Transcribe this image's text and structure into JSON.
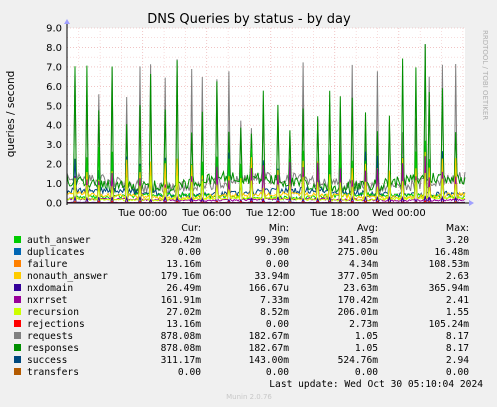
{
  "chart_data": {
    "type": "line",
    "title": "DNS Queries by status - by day",
    "ylabel": "queries / second",
    "ylim": [
      0,
      9
    ],
    "yticks": [
      "0.0",
      "1.0",
      "2.0",
      "3.0",
      "4.0",
      "5.0",
      "6.0",
      "7.0",
      "8.0",
      "9.0"
    ],
    "xticks": [
      "Tue 00:00",
      "Tue 06:00",
      "Tue 12:00",
      "Tue 18:00",
      "Wed 00:00"
    ],
    "x_range_hours": [
      -7.1,
      30.2
    ],
    "xtick_hours": [
      0,
      6,
      12,
      18,
      24
    ],
    "grid": true,
    "watermark": "RRDTOOL / TOBI OETIKER",
    "columns": [
      "Cur:",
      "Min:",
      "Avg:",
      "Max:"
    ],
    "series": [
      {
        "name": "auth_answer",
        "color": "#00cc00",
        "cur": "320.42m",
        "min": "99.39m",
        "avg": "341.85m",
        "max": "3.20"
      },
      {
        "name": "duplicates",
        "color": "#0066b3",
        "cur": "0.00",
        "min": "0.00",
        "avg": "275.00u",
        "max": "16.48m"
      },
      {
        "name": "failure",
        "color": "#ff8000",
        "cur": "13.16m",
        "min": "0.00",
        "avg": "4.34m",
        "max": "108.53m"
      },
      {
        "name": "nonauth_answer",
        "color": "#ffcc00",
        "cur": "179.16m",
        "min": "33.94m",
        "avg": "377.05m",
        "max": "2.63"
      },
      {
        "name": "nxdomain",
        "color": "#330099",
        "cur": "26.49m",
        "min": "166.67u",
        "avg": "23.63m",
        "max": "365.94m"
      },
      {
        "name": "nxrrset",
        "color": "#990099",
        "cur": "161.91m",
        "min": "7.33m",
        "avg": "170.42m",
        "max": "2.41"
      },
      {
        "name": "recursion",
        "color": "#ccff00",
        "cur": "27.02m",
        "min": "8.52m",
        "avg": "206.01m",
        "max": "1.55"
      },
      {
        "name": "rejections",
        "color": "#ff0000",
        "cur": "13.16m",
        "min": "0.00",
        "avg": "2.73m",
        "max": "105.24m"
      },
      {
        "name": "requests",
        "color": "#808080",
        "cur": "878.08m",
        "min": "182.67m",
        "avg": "1.05",
        "max": "8.17"
      },
      {
        "name": "responses",
        "color": "#008f00",
        "cur": "878.08m",
        "min": "182.67m",
        "avg": "1.05",
        "max": "8.17"
      },
      {
        "name": "success",
        "color": "#00487d",
        "cur": "311.17m",
        "min": "143.00m",
        "avg": "524.76m",
        "max": "2.94"
      },
      {
        "name": "transfers",
        "color": "#b35a00",
        "cur": "0.00",
        "min": "0.00",
        "avg": "0.00",
        "max": "0.00"
      }
    ],
    "last_update": "Last update: Wed Oct 30 05:10:04 2024",
    "footer": "Munin 2.0.76"
  }
}
